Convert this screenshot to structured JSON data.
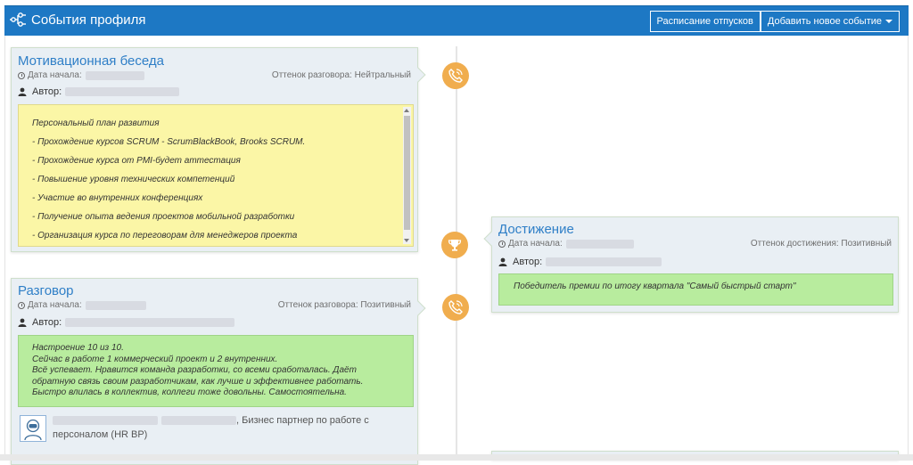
{
  "header": {
    "title": "События профиля",
    "vacation_button": "Расписание отпусков",
    "add_event_button": "Добавить новое событие"
  },
  "colors": {
    "header_bg": "#1d78c4",
    "title_link": "#2f7fc7",
    "node": "#f0ad4e",
    "note_yellow": "#fbf6a6",
    "note_green": "#b8ec9e"
  },
  "events": [
    {
      "title": "Мотивационная беседа",
      "start_label": "Дата начала:",
      "author_label": "Автор:",
      "tone": "Оттенок разговора: Нейтральный",
      "icon": "phone-icon",
      "notes": [
        "Персональный план развития",
        "- Прохождение курсов SCRUM - ScrumBlackBook, Brooks SCRUM.",
        "- Прохождение курса от PMI-будет аттестация",
        "- Повышение уровня технических компетенций",
        "- Участие во внутренних конференциях",
        "- Получение опыта ведения проектов мобильной разработки",
        "- Организация курса по переговорам для менеджеров проекта"
      ]
    },
    {
      "title": "Достижение",
      "start_label": "Дата начала:",
      "author_label": "Автор:",
      "tone": "Оттенок достижения: Позитивный",
      "icon": "trophy-icon",
      "notes": [
        "Победитель премии по итогу квартала \"Самый быстрый старт\""
      ]
    },
    {
      "title": "Разговор",
      "start_label": "Дата начала:",
      "author_label": "Автор:",
      "tone": "Оттенок разговора: Позитивный",
      "icon": "phone-icon",
      "notes": [
        "Настроение 10 из 10.",
        "Сейчас в работе 1 коммерческий проект и 2 внутренних.",
        "Всё успевает. Нравится команда разработки, со всеми сработалась. Даёт",
        "обратную связь своим разработчикам, как лучше и эффективнее работать.",
        "Быстро влилась в коллектив, коллеги тоже довольны. Самостоятельна."
      ],
      "participant_role": ", Бизнес партнер по работе с",
      "participant_role_2": "персоналом (HR BP)"
    }
  ]
}
